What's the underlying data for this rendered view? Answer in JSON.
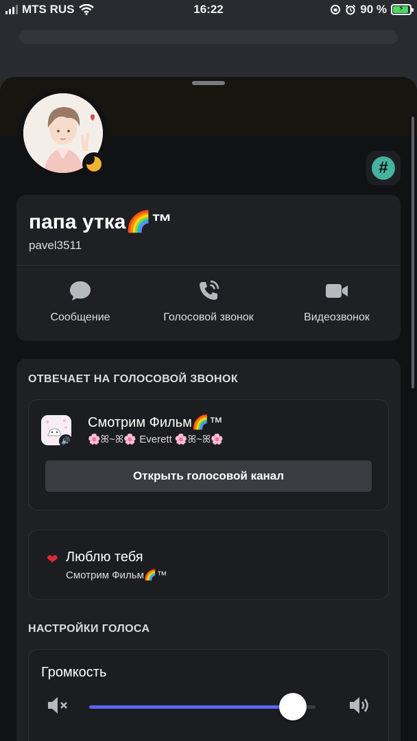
{
  "status_bar": {
    "carrier": "MTS RUS",
    "time": "16:22",
    "battery_percent": "90 %",
    "battery_level": 0.9
  },
  "profile": {
    "display_name": "папа утка🌈™",
    "username": "pavel3511",
    "status": "idle",
    "actions": [
      {
        "label": "Сообщение",
        "icon": "chat-bubble-icon"
      },
      {
        "label": "Голосовой звонок",
        "icon": "phone-call-icon"
      },
      {
        "label": "Видеозвонок",
        "icon": "video-camera-icon"
      }
    ]
  },
  "voice": {
    "section_title": "ОТВЕЧАЕТ НА ГОЛОСОВОЙ ЗВОНОК",
    "channel_name": "Смотрим Фильм🌈™",
    "server_name": "🌸ꕤ~ꕤ🌸 Everett 🌸ꕤ~ꕤ🌸",
    "open_button": "Открыть голосовой канал"
  },
  "activity": {
    "icon": "heart-icon",
    "title": "Люблю тебя",
    "subtitle": "Смотрим Фильм🌈™"
  },
  "voice_settings": {
    "section_title": "НАСТРОЙКИ ГОЛОСА",
    "volume_label": "Громкость",
    "volume_level": 0.9
  },
  "colors": {
    "accent": "#5865f2",
    "idle": "#f0b232",
    "hash_badge": "#45b39e",
    "charging": "#4cd964"
  }
}
